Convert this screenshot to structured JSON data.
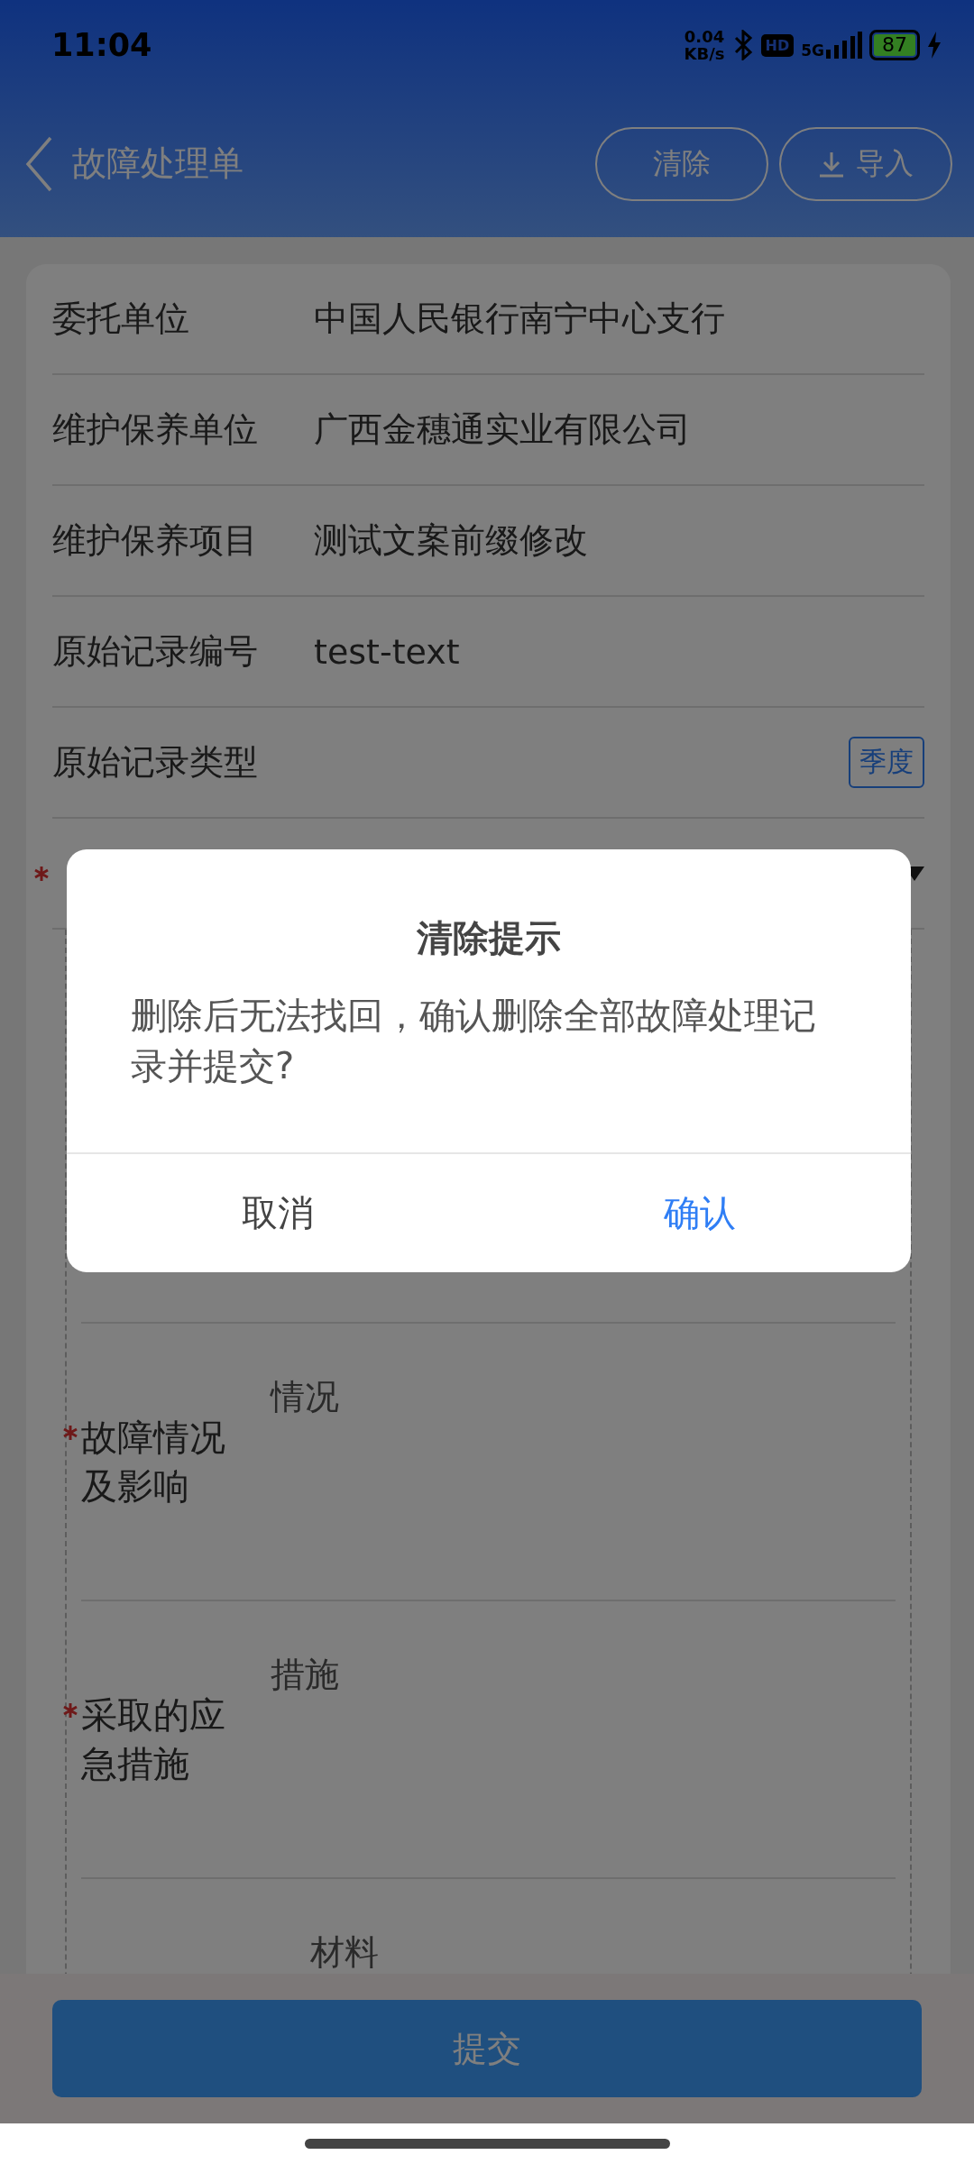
{
  "status_bar": {
    "time": "11:04",
    "net_speed": "0.04",
    "net_unit": "KB/s",
    "hd": "HD",
    "network": "5G",
    "battery": "87"
  },
  "header": {
    "title": "故障处理单",
    "buttons": [
      {
        "label": "清除",
        "kind": "plain"
      },
      {
        "label": "导入",
        "kind": "import"
      }
    ]
  },
  "info_rows": [
    {
      "label": "委托单位",
      "value": "中国人民银行南宁中心支行"
    },
    {
      "label": "维护保养单位",
      "value": "广西金穗通实业有限公司"
    },
    {
      "label": "维护保养项目",
      "value": "测试文案前缀修改"
    },
    {
      "label": "原始记录编号",
      "value": "test-text"
    },
    {
      "label": "原始记录类型",
      "tag": "季度"
    }
  ],
  "select_row": {
    "required": true
  },
  "fault_rows": [
    {
      "label": "故障情况及影响",
      "placeholder": "情况",
      "required": true
    },
    {
      "label": "采取的应急措施",
      "placeholder": "措施",
      "required": true
    },
    {
      "placeholder": "材料"
    }
  ],
  "submit": "提交",
  "dialog": {
    "title": "清除提示",
    "message": "删除后无法找回，确认删除全部故障处理记录并提交?",
    "buttons": [
      {
        "label": "取消",
        "kind": "cancel"
      },
      {
        "label": "确认",
        "kind": "confirm"
      }
    ]
  }
}
